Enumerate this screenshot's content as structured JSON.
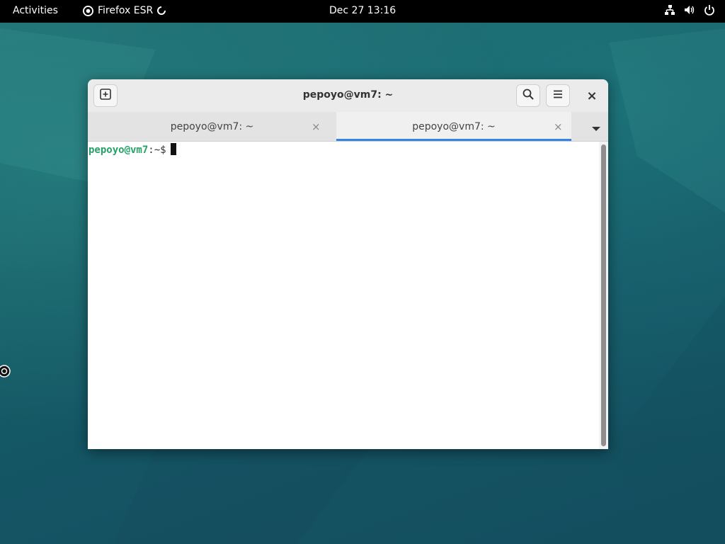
{
  "topbar": {
    "activities": "Activities",
    "app_name": "Firefox ESR",
    "clock": "Dec 27  13:16",
    "icons": [
      "network-icon",
      "volume-icon",
      "power-icon"
    ]
  },
  "window": {
    "title": "pepoyo@vm7: ~",
    "tabs": [
      {
        "label": "pepoyo@vm7: ~",
        "active": false
      },
      {
        "label": "pepoyo@vm7: ~",
        "active": true
      }
    ],
    "tab_close_glyph": "×",
    "close_glyph": "×"
  },
  "terminal": {
    "user_host": "pepoyo@vm7",
    "path": ":~$"
  },
  "colors": {
    "accent": "#3584e4",
    "prompt_user": "#26a269"
  }
}
